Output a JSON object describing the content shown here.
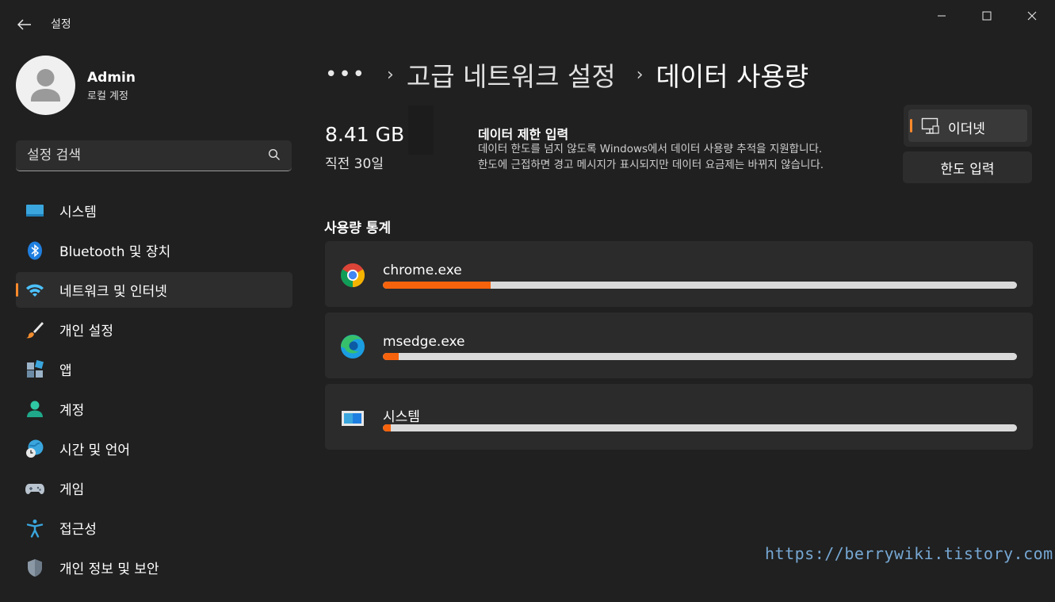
{
  "window": {
    "title": "설정"
  },
  "profile": {
    "name": "Admin",
    "subtitle": "로컬 계정"
  },
  "search": {
    "placeholder": "설정 검색"
  },
  "sidebar": {
    "items": [
      {
        "label": "시스템",
        "icon": "system-icon",
        "active": false
      },
      {
        "label": "Bluetooth 및 장치",
        "icon": "bluetooth-icon",
        "active": false
      },
      {
        "label": "네트워크 및 인터넷",
        "icon": "wifi-icon",
        "active": true
      },
      {
        "label": "개인 설정",
        "icon": "paintbrush-icon",
        "active": false
      },
      {
        "label": "앱",
        "icon": "apps-icon",
        "active": false
      },
      {
        "label": "계정",
        "icon": "account-icon",
        "active": false
      },
      {
        "label": "시간 및 언어",
        "icon": "globe-clock-icon",
        "active": false
      },
      {
        "label": "게임",
        "icon": "gamepad-icon",
        "active": false
      },
      {
        "label": "접근성",
        "icon": "accessibility-icon",
        "active": false
      },
      {
        "label": "개인 정보 및 보안",
        "icon": "shield-icon",
        "active": false
      }
    ]
  },
  "breadcrumb": {
    "more": "•••",
    "parent": "고급 네트워크 설정",
    "current": "데이터 사용량"
  },
  "usage": {
    "total": "8.41 GB",
    "period": "직전 30일"
  },
  "data_limit": {
    "title": "데이터 제한 입력",
    "description_line1": "데이터 한도를 넘지 않도록 Windows에서 데이터 사용량 추적을 지원합니다.",
    "description_line2": "한도에 근접하면 경고 메시지가 표시되지만 데이터 요금제는 바뀌지 않습니다.",
    "network_selected": "이더넷",
    "limit_button": "한도 입력"
  },
  "stats": {
    "heading": "사용량 통계",
    "apps": [
      {
        "name": "chrome.exe",
        "icon": "chrome-icon",
        "share": 0.17
      },
      {
        "name": "msedge.exe",
        "icon": "edge-icon",
        "share": 0.025
      },
      {
        "name": "시스템",
        "icon": "system-app-icon",
        "share": 0.012
      }
    ]
  },
  "colors": {
    "accent": "#ff8a2b",
    "bar_fill": "#f7630c",
    "bar_track": "#dadada",
    "background": "#202020"
  },
  "watermark": "https://berrywiki.tistory.com"
}
